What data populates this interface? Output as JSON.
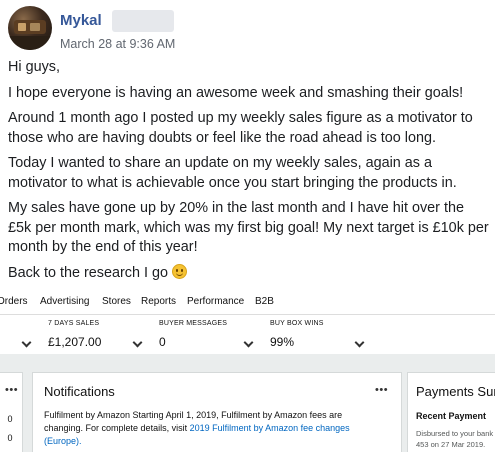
{
  "post": {
    "author": "Mykal",
    "timestamp": "March 28 at 9:36 AM",
    "paragraphs": [
      "Hi guys,",
      "I hope everyone is having an awesome week and smashing their goals!",
      "Around 1 month ago I posted up my weekly sales figure as a motivator to those who are having doubts or feel like the road ahead is too long.",
      "Today I wanted to share an update on my weekly sales, again as a motivator to what is achievable once you start bringing the products in.",
      "My sales have gone up by 20% in the last month and I have hit over the £5k per month mark, which was my first big goal! My next target is £10k per month by the end of this year!"
    ],
    "closing": "Back to the research I go",
    "emoji": "smiley-face-icon"
  },
  "seller_central": {
    "nav": [
      "Orders",
      "Advertising",
      "Stores",
      "Reports",
      "Performance",
      "B2B"
    ],
    "metrics": [
      {
        "label": "7 DAYS SALES",
        "value": "£1,207.00"
      },
      {
        "label": "BUYER MESSAGES",
        "value": "0"
      },
      {
        "label": "BUY BOX WINS",
        "value": "99%"
      }
    ],
    "left_column": [
      "0",
      "0"
    ],
    "notifications": {
      "title": "Notifications",
      "text_prefix": "Fulfilment by Amazon",
      "text_body": " Starting April 1, 2019, Fulfilment by Amazon fees are changing. For complete details, visit ",
      "link": "2019 Fulfilment by Amazon fee changes",
      "link_suffix": "(Europe)."
    },
    "payments": {
      "title": "Payments Sum",
      "recent_label": "Recent Payment",
      "sub_line1": "Disbursed to your bank",
      "sub_line2": "453 on 27 Mar 2019."
    },
    "dots": "•••"
  },
  "colors": {
    "author_link": "#365899",
    "amazon_link": "#0066c0",
    "amazon_bg": "#eaeded"
  }
}
